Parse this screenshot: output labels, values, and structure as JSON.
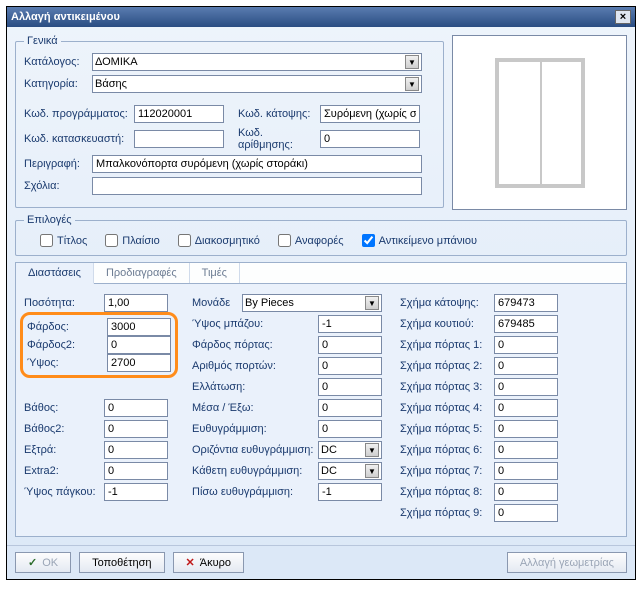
{
  "window": {
    "title": "Αλλαγή αντικειμένου"
  },
  "general": {
    "legend": "Γενικά",
    "catalog_label": "Κατάλογος:",
    "catalog_value": "ΔΟΜΙΚΑ",
    "category_label": "Κατηγορία:",
    "category_value": "Βάσης",
    "progcode_label": "Κωδ. προγράμματος:",
    "progcode_value": "112020001",
    "topview_label": "Κωδ. κάτοψης:",
    "topview_value": "Συρόμενη (χωρίς σ",
    "mfr_label": "Κωδ. κατασκευαστή:",
    "mfr_value": "",
    "num_label": "Κωδ. αρίθμησης:",
    "num_value": "0",
    "descr_label": "Περιγραφή:",
    "descr_value": "Μπαλκονόπορτα συρόμενη (χωρίς στοράκι)",
    "comments_label": "Σχόλια:",
    "comments_value": ""
  },
  "options": {
    "legend": "Επιλογές",
    "title": "Τίτλος",
    "frame": "Πλαίσιο",
    "decor": "Διακοσμητικό",
    "reports": "Αναφορές",
    "bath": "Αντικείμενο μπάνιου"
  },
  "tabs": {
    "dims": "Διαστάσεις",
    "specs": "Προδιαγραφές",
    "prices": "Τιμές"
  },
  "dims": {
    "qty_label": "Ποσότητα:",
    "qty_value": "1,00",
    "unit_label": "Μονάδε",
    "unit_value": "By Pieces",
    "width_label": "Φάρδος:",
    "width_value": "3000",
    "width2_label": "Φάρδος2:",
    "width2_value": "0",
    "height_label": "Ύψος:",
    "height_value": "2700",
    "depth_label": "Βάθος:",
    "depth_value": "0",
    "depth2_label": "Βάθος2:",
    "depth2_value": "0",
    "extra_label": "Εξτρά:",
    "extra_value": "0",
    "extra2_label": "Extra2:",
    "extra2_value": "0",
    "bench_label": "Ύψος πάγκου:",
    "bench_value": "-1",
    "mbazou_label": "Ύψος μπάζου:",
    "mbazou_value": "-1",
    "doorw_label": "Φάρδος πόρτας:",
    "doorw_value": "0",
    "doorn_label": "Αριθμός πορτών:",
    "doorn_value": "0",
    "reduce_label": "Ελλάτωση:",
    "reduce_value": "0",
    "inout_label": "Μέσα / Έξω:",
    "inout_value": "0",
    "align_label": "Ευθυγράμμιση:",
    "align_value": "0",
    "halign_label": "Οριζόντια ευθυγράμμιση:",
    "halign_value": "DC",
    "valign_label": "Κάθετη ευθυγράμμιση:",
    "valign_value": "DC",
    "balign_label": "Πίσω ευθυγράμμιση:",
    "balign_value": "-1",
    "topshape_label": "Σχήμα κάτοψης:",
    "topshape_value": "679473",
    "boxshape_label": "Σχήμα κουτιού:",
    "boxshape_value": "679485",
    "door1_label": "Σχήμα πόρτας 1:",
    "door1_value": "0",
    "door2_label": "Σχήμα πόρτας 2:",
    "door2_value": "0",
    "door3_label": "Σχήμα πόρτας 3:",
    "door3_value": "0",
    "door4_label": "Σχήμα πόρτας 4:",
    "door4_value": "0",
    "door5_label": "Σχήμα πόρτας 5:",
    "door5_value": "0",
    "door6_label": "Σχήμα πόρτας 6:",
    "door6_value": "0",
    "door7_label": "Σχήμα πόρτας 7:",
    "door7_value": "0",
    "door8_label": "Σχήμα πόρτας 8:",
    "door8_value": "0",
    "door9_label": "Σχήμα πόρτας 9:",
    "door9_value": "0"
  },
  "buttons": {
    "ok": "OK",
    "place": "Τοποθέτηση",
    "cancel": "Άκυρο",
    "geom": "Αλλαγή γεωμετρίας"
  }
}
